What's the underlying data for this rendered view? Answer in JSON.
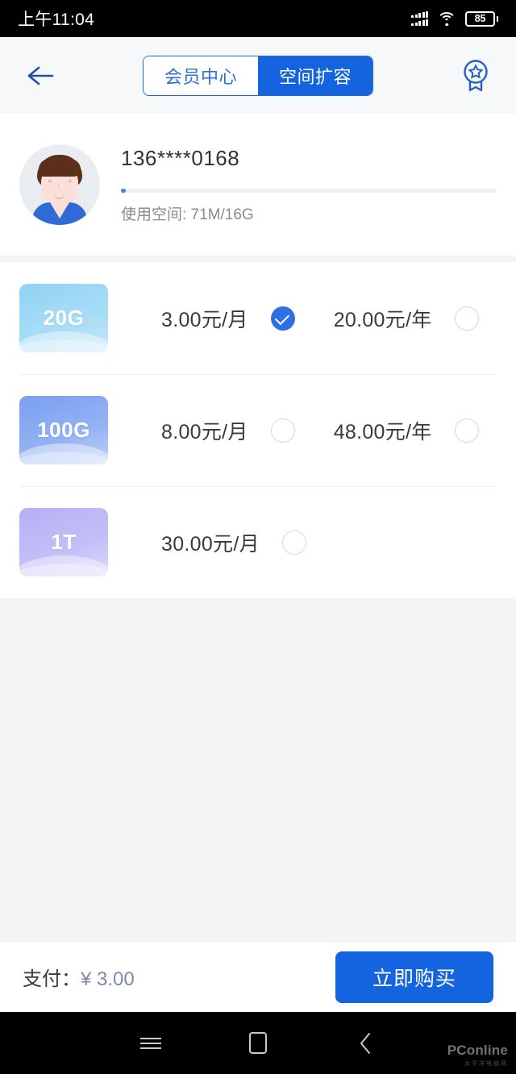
{
  "status_bar": {
    "time": "上午11:04",
    "battery_percent": "85",
    "icons": [
      "signal-icon",
      "wifi-icon",
      "battery-icon"
    ]
  },
  "header": {
    "back_icon": "arrow-left-icon",
    "medal_icon": "medal-badge-icon",
    "tabs": [
      {
        "label": "会员中心",
        "active": false
      },
      {
        "label": "空间扩容",
        "active": true
      }
    ]
  },
  "profile": {
    "avatar": "user-avatar",
    "phone": "136****0168",
    "usage_text": "使用空间: 71M/16G",
    "used": "71M",
    "total": "16G",
    "progress_percent": 1.2
  },
  "plans": [
    {
      "tier": "20G",
      "tier_color_start": "#8fd3f4",
      "tier_color_end": "#bfe6f7",
      "monthly": {
        "price": "3.00元/月",
        "selected": true
      },
      "yearly": {
        "price": "20.00元/年",
        "selected": false
      }
    },
    {
      "tier": "100G",
      "tier_color_start": "#7a9ef0",
      "tier_color_end": "#b9cdf7",
      "monthly": {
        "price": "8.00元/月",
        "selected": false
      },
      "yearly": {
        "price": "48.00元/年",
        "selected": false
      }
    },
    {
      "tier": "1T",
      "tier_color_start": "#b6b0f5",
      "tier_color_end": "#d6d3fa",
      "monthly": {
        "price": "30.00元/月",
        "selected": false
      },
      "yearly": null
    }
  ],
  "pay_bar": {
    "label": "支付：",
    "amount": "¥ 3.00",
    "buy_label": "立即购买"
  },
  "nav_bar": {
    "menu_icon": "menu-icon",
    "home_icon": "home-square-icon",
    "back_icon": "chevron-left-icon"
  },
  "watermark": {
    "main": "PConline",
    "sub": "太平洋电脑网"
  },
  "colors": {
    "accent": "#1464e0",
    "accent_soft": "#2f6fe4",
    "page_bg": "#f5f5f7",
    "card_bg": "#ffffff"
  }
}
